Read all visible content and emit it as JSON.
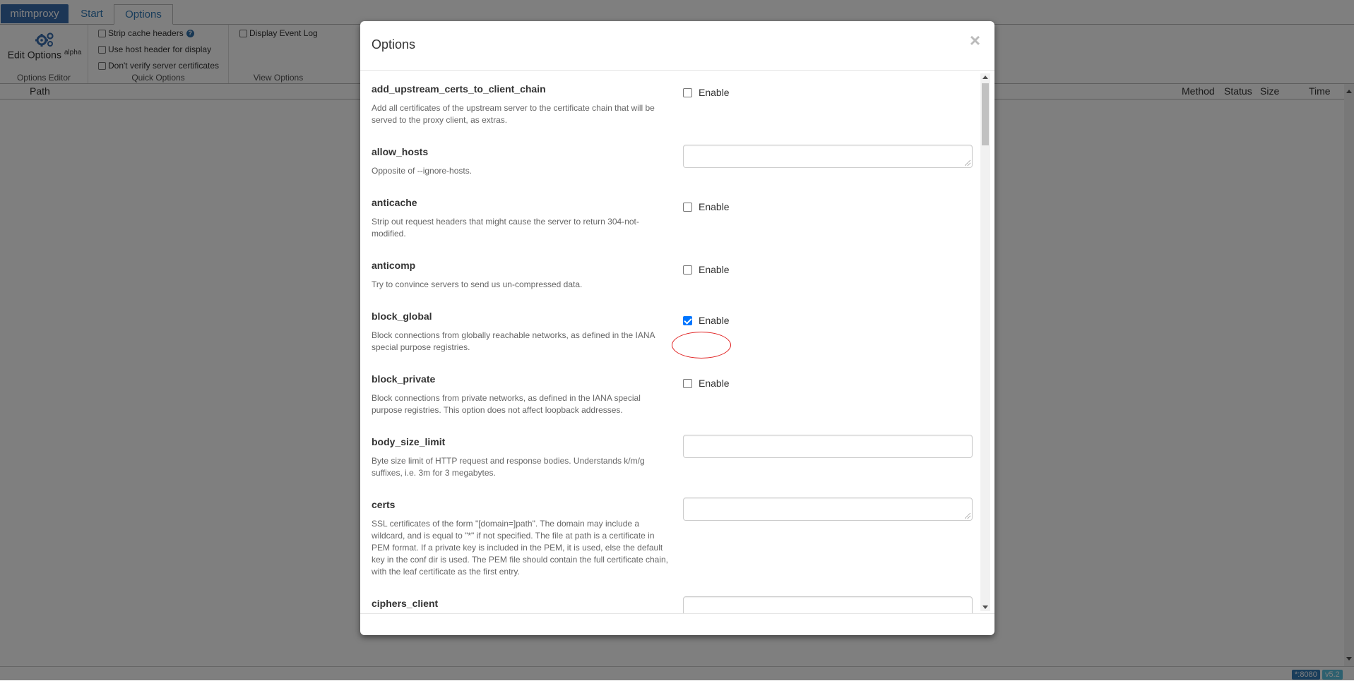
{
  "nav": {
    "brand": "mitmproxy",
    "tabs": [
      {
        "label": "Start"
      },
      {
        "label": "Options"
      }
    ]
  },
  "ribbon": {
    "edit_options": {
      "label": "Edit Options",
      "badge": "alpha"
    },
    "groups": {
      "editor": "Options Editor",
      "quick": "Quick Options",
      "view": "View Options"
    },
    "quick_options": [
      {
        "label": "Strip cache headers",
        "checked": false,
        "help": "?"
      },
      {
        "label": "Use host header for display",
        "checked": false
      },
      {
        "label": "Don't verify server certificates",
        "checked": false
      }
    ],
    "view_options": [
      {
        "label": "Display Event Log",
        "checked": false
      }
    ]
  },
  "table": {
    "columns": {
      "path": "Path",
      "method": "Method",
      "status": "Status",
      "size": "Size",
      "time": "Time"
    }
  },
  "footer": {
    "port": "*:8080",
    "version": "v5.2"
  },
  "modal": {
    "title": "Options",
    "close": "×",
    "enable_label": "Enable",
    "options": [
      {
        "name": "add_upstream_certs_to_client_chain",
        "type": "checkbox",
        "checked": false,
        "description": "Add all certificates of the upstream server to the certificate chain that will be served to the proxy client, as extras."
      },
      {
        "name": "allow_hosts",
        "type": "textarea",
        "value": "",
        "description": "Opposite of --ignore-hosts."
      },
      {
        "name": "anticache",
        "type": "checkbox",
        "checked": false,
        "description": "Strip out request headers that might cause the server to return 304-not-modified."
      },
      {
        "name": "anticomp",
        "type": "checkbox",
        "checked": false,
        "description": "Try to convince servers to send us un-compressed data."
      },
      {
        "name": "block_global",
        "type": "checkbox",
        "checked": true,
        "description": "Block connections from globally reachable networks, as defined in the IANA special purpose registries."
      },
      {
        "name": "block_private",
        "type": "checkbox",
        "checked": false,
        "description": "Block connections from private networks, as defined in the IANA special purpose registries. This option does not affect loopback addresses."
      },
      {
        "name": "body_size_limit",
        "type": "text",
        "value": "",
        "description": "Byte size limit of HTTP request and response bodies. Understands k/m/g suffixes, i.e. 3m for 3 megabytes."
      },
      {
        "name": "certs",
        "type": "textarea",
        "value": "",
        "description": "SSL certificates of the form \"[domain=]path\". The domain may include a wildcard, and is equal to \"*\" if not specified. The file at path is a certificate in PEM format. If a private key is included in the PEM, it is used, else the default key in the conf dir is used. The PEM file should contain the full certificate chain, with the leaf certificate as the first entry."
      },
      {
        "name": "ciphers_client",
        "type": "text",
        "value": ""
      }
    ]
  }
}
